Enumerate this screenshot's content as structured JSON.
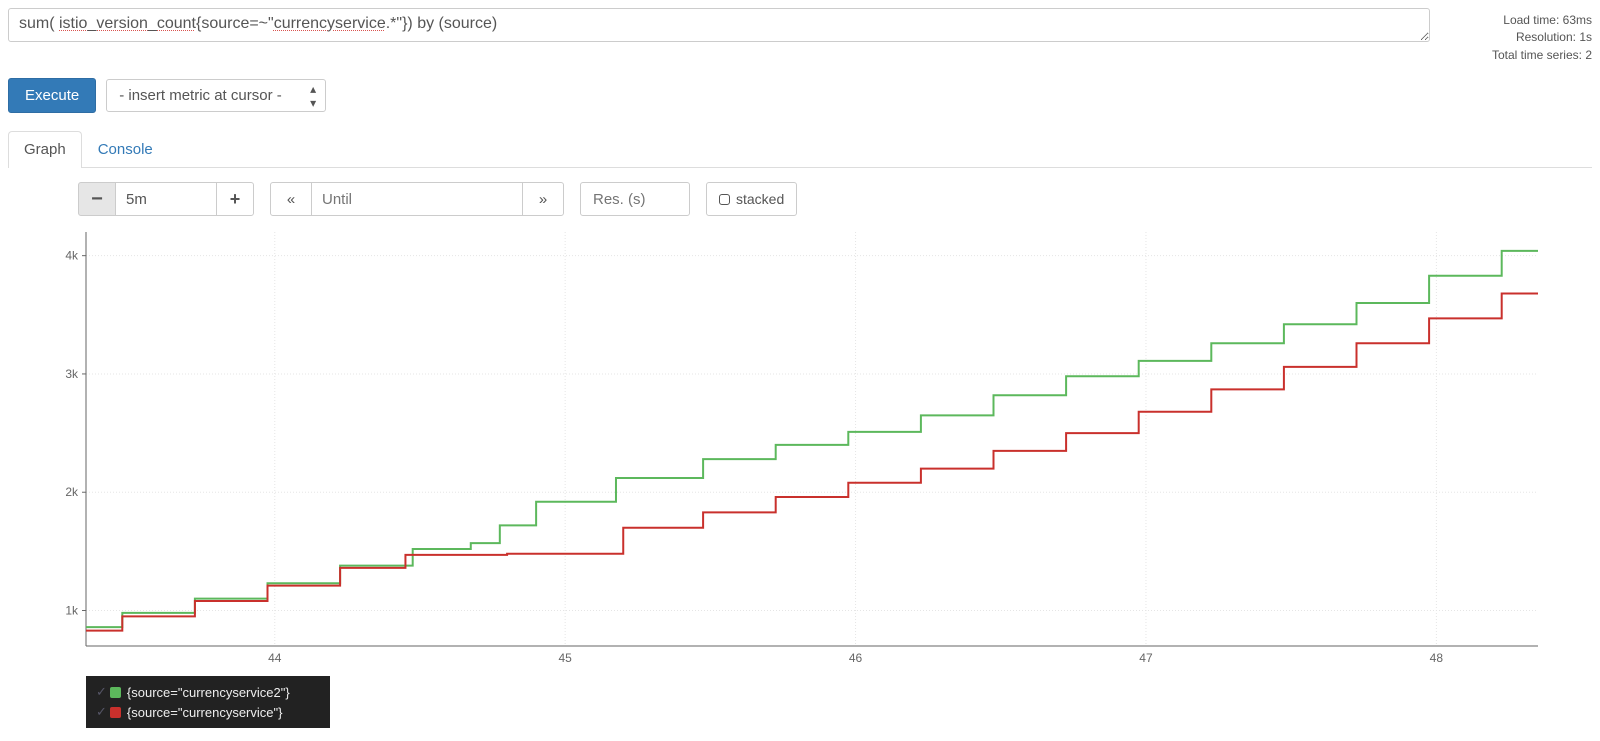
{
  "query": {
    "raw": "sum( istio_version_count{source=~\"currencyservice.*\"}) by (source)",
    "parts": [
      "sum( ",
      "istio_version_count",
      "{source=~\"",
      "currencyservice",
      ".*\"}) by (source)"
    ]
  },
  "stats": {
    "load_time_label": "Load time: 63ms",
    "resolution_label": "Resolution: 1s",
    "total_series_label": "Total time series: 2"
  },
  "buttons": {
    "execute": "Execute",
    "insert_metric_placeholder": "- insert metric at cursor -",
    "stacked": "stacked"
  },
  "tabs": {
    "graph": "Graph",
    "console": "Console"
  },
  "range": {
    "minus": "−",
    "value": "5m",
    "plus": "+",
    "back": "«",
    "until_placeholder": "Until",
    "forward": "»",
    "res_placeholder": "Res. (s)"
  },
  "chart_data": {
    "type": "line",
    "xlabel": "",
    "ylabel": "",
    "x_ticks": [
      44,
      45,
      46,
      47,
      48
    ],
    "x_range": [
      43.35,
      48.35
    ],
    "y_ticks": [
      1000,
      2000,
      3000,
      4000
    ],
    "y_tick_labels": [
      "1k",
      "2k",
      "3k",
      "4k"
    ],
    "y_range": [
      700,
      4200
    ],
    "series": [
      {
        "name": "{source=\"currencyservice2\"}",
        "color": "#5cb85c",
        "x": [
          43.35,
          43.6,
          43.85,
          44.1,
          44.35,
          44.6,
          44.75,
          44.8,
          45.0,
          45.35,
          45.6,
          45.85,
          46.1,
          46.35,
          46.6,
          46.85,
          47.1,
          47.35,
          47.6,
          47.85,
          48.1,
          48.35
        ],
        "values": [
          860,
          980,
          1100,
          1230,
          1380,
          1520,
          1570,
          1720,
          1920,
          2120,
          2280,
          2400,
          2510,
          2650,
          2820,
          2980,
          3110,
          3260,
          3420,
          3600,
          3830,
          4040
        ]
      },
      {
        "name": "{source=\"currencyservice\"}",
        "color": "#c9302c",
        "x": [
          43.35,
          43.6,
          43.85,
          44.1,
          44.35,
          44.55,
          45.05,
          45.35,
          45.6,
          45.85,
          46.1,
          46.35,
          46.6,
          46.85,
          47.1,
          47.35,
          47.6,
          47.85,
          48.1,
          48.35
        ],
        "values": [
          830,
          950,
          1080,
          1210,
          1360,
          1470,
          1480,
          1700,
          1830,
          1960,
          2080,
          2200,
          2350,
          2500,
          2680,
          2870,
          3060,
          3260,
          3470,
          3680
        ]
      }
    ]
  },
  "colors": {
    "primary": "#337ab7",
    "legend_bg": "#222222"
  }
}
